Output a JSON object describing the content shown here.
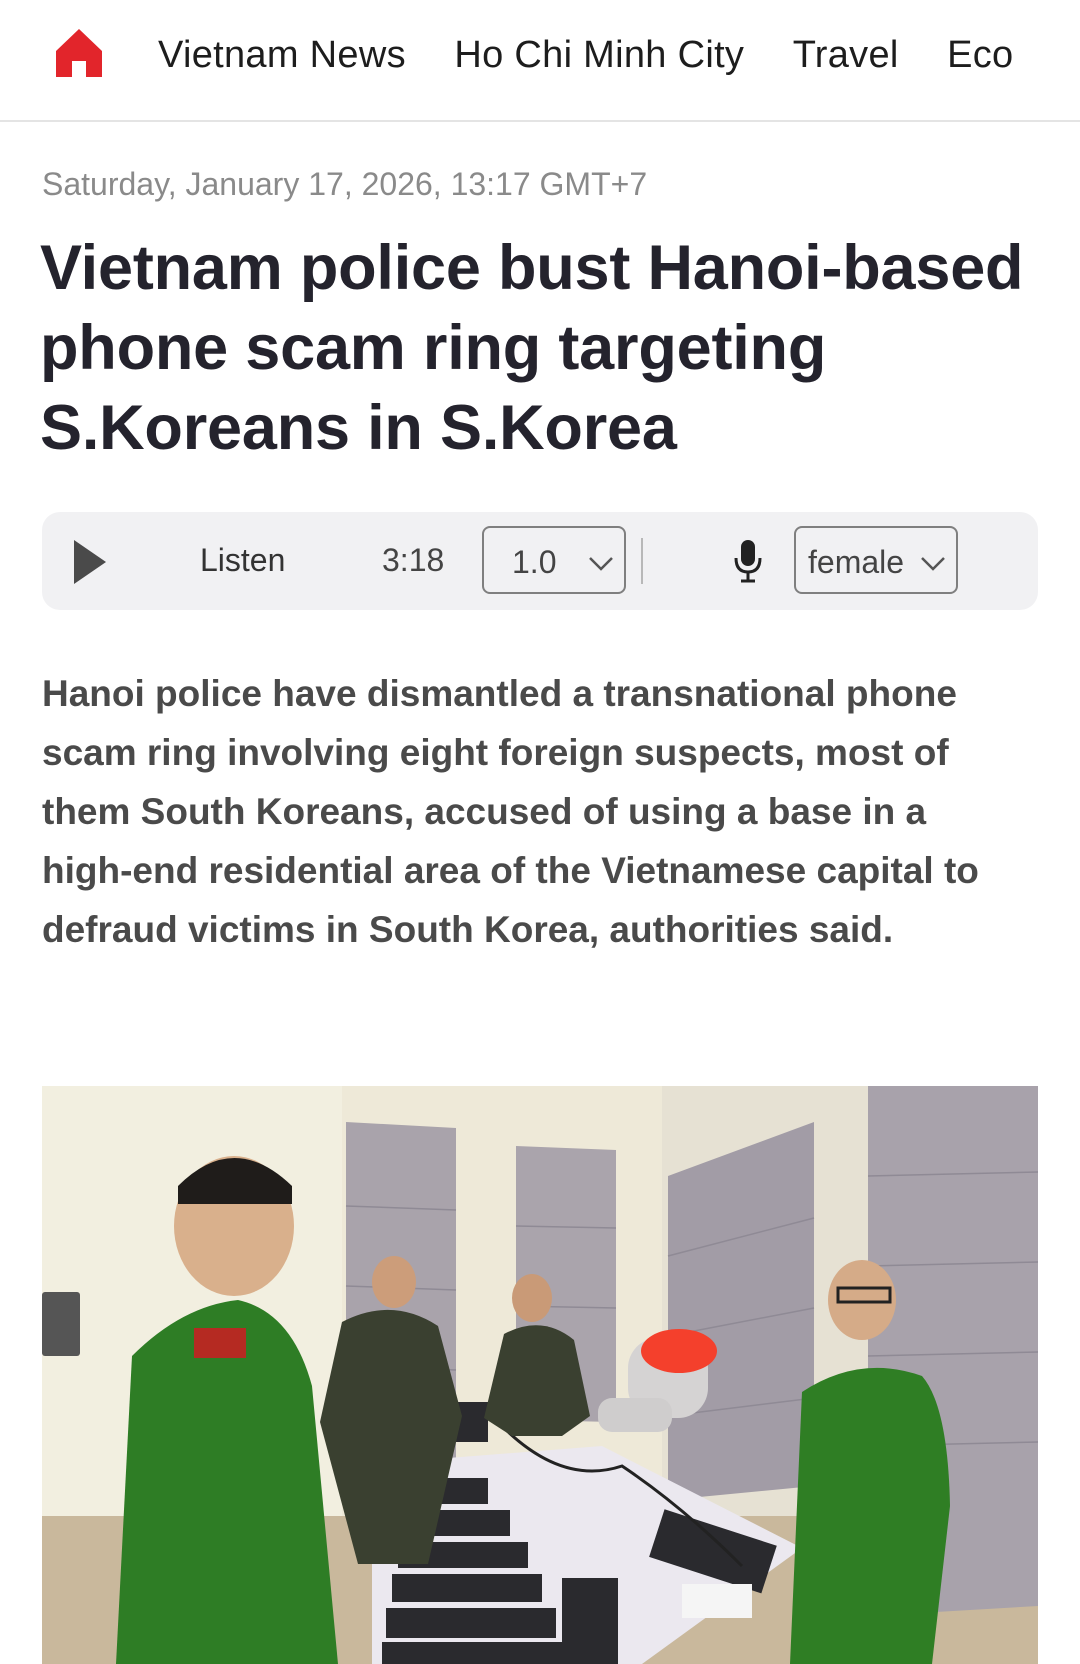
{
  "nav": {
    "home_icon": "home-icon",
    "items": [
      "Vietnam News",
      "Ho Chi Minh City",
      "Travel",
      "Eco"
    ]
  },
  "article": {
    "dateline": "Saturday, January 17, 2026, 13:17 GMT+7",
    "headline": "Vietnam police bust Hanoi-based phone scam ring targeting S.Koreans in S.Korea",
    "lede": "Hanoi police have dismantled a transnational phone scam ring involving eight foreign suspects, most of them South Koreans, accused of using a base in a high-end residential area of the Vietnamese capital to defraud victims in South Korea, authorities said."
  },
  "player": {
    "play_icon": "play-icon",
    "listen_label": "Listen",
    "duration": "3:18",
    "speed_value": "1.0",
    "mic_icon": "microphone-icon",
    "voice_value": "female"
  },
  "colors": {
    "brand_red": "#e2252b",
    "headline": "#24232d",
    "player_bg": "#f1f1f3"
  }
}
